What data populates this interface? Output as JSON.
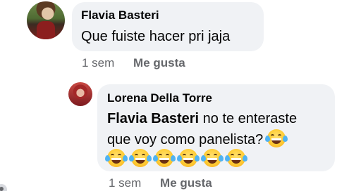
{
  "comments": [
    {
      "author": "Flavia Basteri",
      "text": "Que fuiste hacer pri jaja",
      "time": "1 sem",
      "like_label": "Me gusta"
    },
    {
      "author": "Lorena Della Torre",
      "mention": "Flavia Basteri",
      "text_line1_rest": " no te enteraste",
      "text_line2": "que voy como panelista?",
      "emoji": "face-with-tears-of-joy",
      "emoji_row_count": 6,
      "time": "1 sem",
      "like_label": "Me gusta"
    }
  ],
  "colors": {
    "bubble": "#f0f2f5",
    "meta_text": "#65676b",
    "primary_text": "#050505"
  }
}
